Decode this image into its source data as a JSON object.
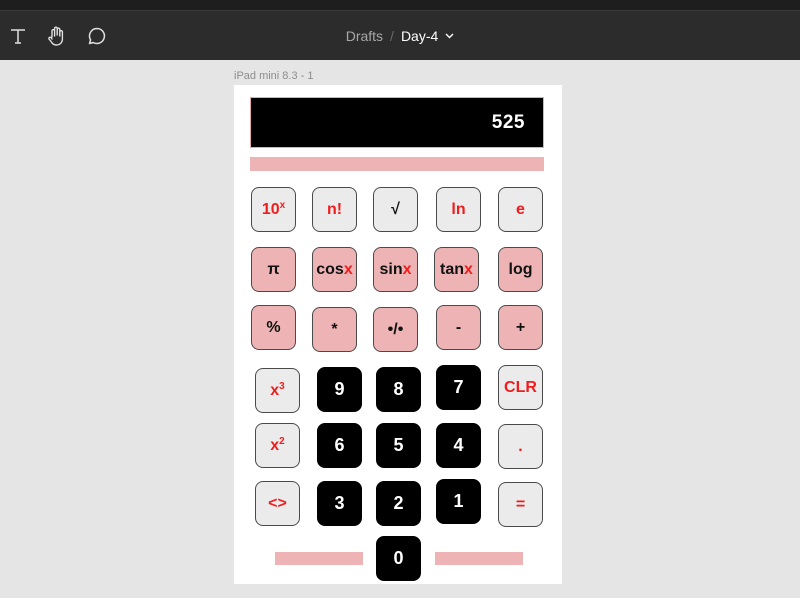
{
  "toolbar": {
    "tools": [
      {
        "name": "text-tool",
        "icon": "text-icon"
      },
      {
        "name": "hand-tool",
        "icon": "hand-icon"
      },
      {
        "name": "comment-tool",
        "icon": "comment-icon"
      }
    ],
    "breadcrumb": {
      "parent": "Drafts",
      "separator": "/",
      "file": "Day-4"
    }
  },
  "frame": {
    "label": "iPad mini 8.3 - 1"
  },
  "calculator": {
    "display": "525",
    "keys": {
      "pow10": {
        "base": "10",
        "sup": "x"
      },
      "factorial": "n!",
      "sqrt": "√",
      "ln": "ln",
      "e": "e",
      "pi": "π",
      "cos": {
        "fn": "cos",
        "var": "x"
      },
      "sin": {
        "fn": "sin",
        "var": "x"
      },
      "tan": {
        "fn": "tan",
        "var": "x"
      },
      "log": "log",
      "percent": "%",
      "multiply": "*",
      "divide": "•/•",
      "minus": "-",
      "plus": "+",
      "cube": {
        "base": "x",
        "sup": "3"
      },
      "square": {
        "base": "x",
        "sup": "2"
      },
      "backspace": "<>",
      "clear": "CLR",
      "dot": ".",
      "equals": "=",
      "d0": "0",
      "d1": "1",
      "d2": "2",
      "d3": "3",
      "d4": "4",
      "d5": "5",
      "d6": "6",
      "d7": "7",
      "d8": "8",
      "d9": "9"
    }
  },
  "colors": {
    "pink": "#eeb4b5",
    "red": "#f01d1d",
    "toolbar": "#2c2c2c",
    "canvas": "#e5e5e5"
  }
}
